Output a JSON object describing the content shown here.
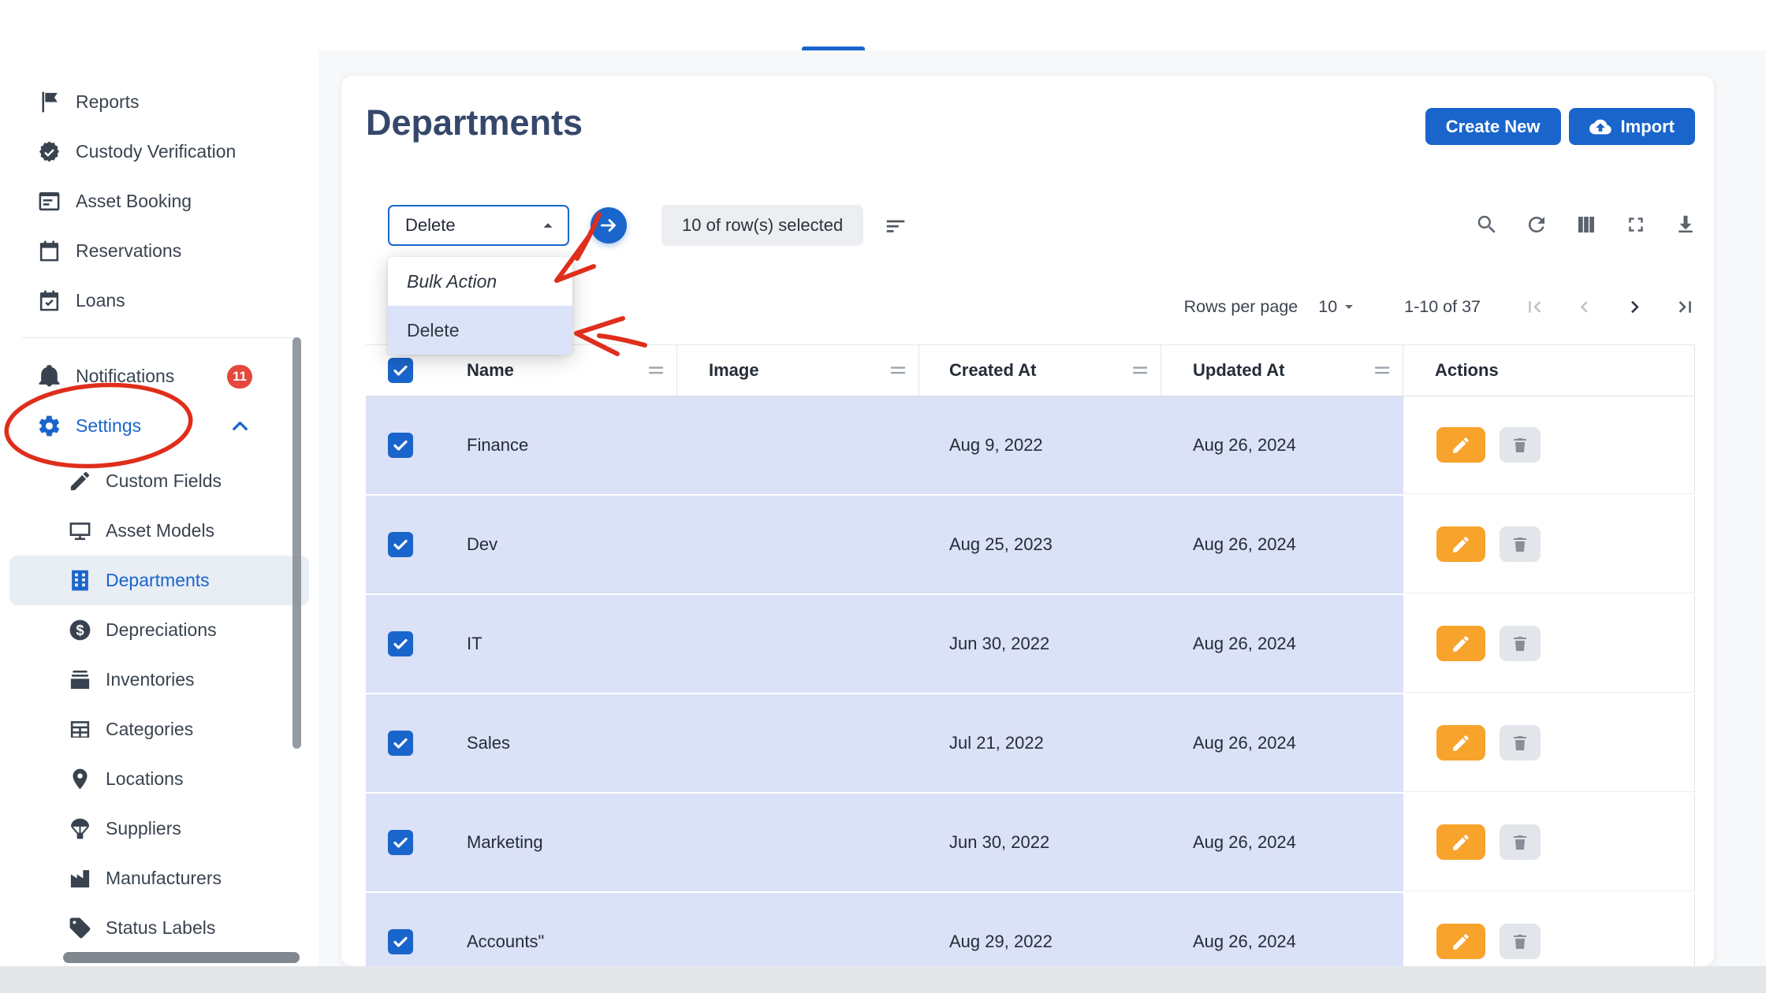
{
  "sidebar": {
    "items": [
      {
        "label": "Reports",
        "icon": "flag-icon"
      },
      {
        "label": "Custody Verification",
        "icon": "verified-badge-icon"
      },
      {
        "label": "Asset Booking",
        "icon": "card-icon"
      },
      {
        "label": "Reservations",
        "icon": "calendar-icon"
      },
      {
        "label": "Loans",
        "icon": "calendar-check-icon"
      },
      {
        "label": "Notifications",
        "icon": "bell-icon",
        "badge": "11"
      },
      {
        "label": "Settings",
        "icon": "gear-icon"
      }
    ],
    "settings_children": [
      {
        "label": "Custom Fields",
        "icon": "pencil-field-icon"
      },
      {
        "label": "Asset Models",
        "icon": "monitor-icon"
      },
      {
        "label": "Departments",
        "icon": "building-icon",
        "active": true
      },
      {
        "label": "Depreciations",
        "icon": "dollar-circle-icon"
      },
      {
        "label": "Inventories",
        "icon": "stack-icon"
      },
      {
        "label": "Categories",
        "icon": "grid-list-icon"
      },
      {
        "label": "Locations",
        "icon": "map-pin-icon"
      },
      {
        "label": "Suppliers",
        "icon": "parachute-box-icon"
      },
      {
        "label": "Manufacturers",
        "icon": "factory-icon"
      },
      {
        "label": "Status Labels",
        "icon": "tag-icon"
      }
    ],
    "active_item": "Departments"
  },
  "page": {
    "title": "Departments",
    "create_button": "Create New",
    "import_button": "Import"
  },
  "toolbar": {
    "bulk_select_value": "Delete",
    "selected_chip": "10 of row(s) selected",
    "menu": {
      "header": "Bulk Action",
      "selected_item": "Delete"
    },
    "icons": [
      "sort-icon",
      "search-icon",
      "refresh-icon",
      "columns-icon",
      "fullscreen-icon",
      "download-icon"
    ]
  },
  "pagination": {
    "rows_per_page_label": "Rows per page",
    "rows_per_page_value": "10",
    "range": "1-10 of 37"
  },
  "table": {
    "columns": [
      "Name",
      "Image",
      "Created At",
      "Updated At",
      "Actions"
    ],
    "rows": [
      {
        "name": "Finance",
        "image": "",
        "created_at": "Aug 9, 2022",
        "updated_at": "Aug 26, 2024",
        "selected": true
      },
      {
        "name": "Dev",
        "image": "",
        "created_at": "Aug 25, 2023",
        "updated_at": "Aug 26, 2024",
        "selected": true
      },
      {
        "name": "IT",
        "image": "",
        "created_at": "Jun 30, 2022",
        "updated_at": "Aug 26, 2024",
        "selected": true
      },
      {
        "name": "Sales",
        "image": "",
        "created_at": "Jul 21, 2022",
        "updated_at": "Aug 26, 2024",
        "selected": true
      },
      {
        "name": "Marketing",
        "image": "",
        "created_at": "Jun 30, 2022",
        "updated_at": "Aug 26, 2024",
        "selected": true
      },
      {
        "name": "Accounts\"",
        "image": "",
        "created_at": "Aug 29, 2022",
        "updated_at": "Aug 26, 2024",
        "selected": true
      }
    ]
  },
  "colors": {
    "accent_blue": "#1a65cb",
    "selected_row": "#dbe1f6",
    "edit_orange": "#f7a32c",
    "badge_red": "#e5483d",
    "annotation_red": "#df2e1b"
  }
}
